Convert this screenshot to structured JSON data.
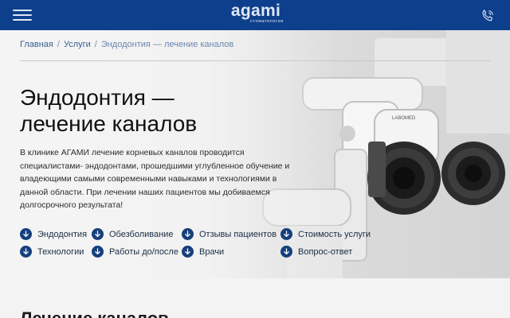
{
  "header": {
    "logo_word": "agami",
    "logo_sub": "стоматология"
  },
  "breadcrumb": {
    "items": [
      "Главная",
      "Услуги",
      "Эндодонтия — лечение каналов"
    ],
    "separator": "/"
  },
  "hero": {
    "title_line1": "Эндодонтия —",
    "title_line2": "лечение каналов",
    "intro": "В клинике АГАМИ лечение корневых каналов проводится специалистами- эндодонтами, прошедшими углубленное обучение и владеющими самыми современными навыками и технологиями в данной области. При лечении наших пациентов мы добиваемся долгосрочного результата!",
    "microscope_brand": "LABOMED"
  },
  "quick_links": [
    "Эндодонтия",
    "Обезболивание",
    "Отзывы пациентов",
    "Стоимость услуги",
    "Технологии",
    "Работы до/после",
    "Врачи",
    "Вопрос-ответ"
  ],
  "section": {
    "title": "Лечение каналов"
  },
  "colors": {
    "header": "#0e3f8c",
    "link_icon": "#163f7d",
    "breadcrumb": "#3a5f92"
  },
  "icons": {
    "menu": "hamburger-menu-icon",
    "phone": "phone-icon",
    "link": "arrow-down-circle-icon"
  }
}
